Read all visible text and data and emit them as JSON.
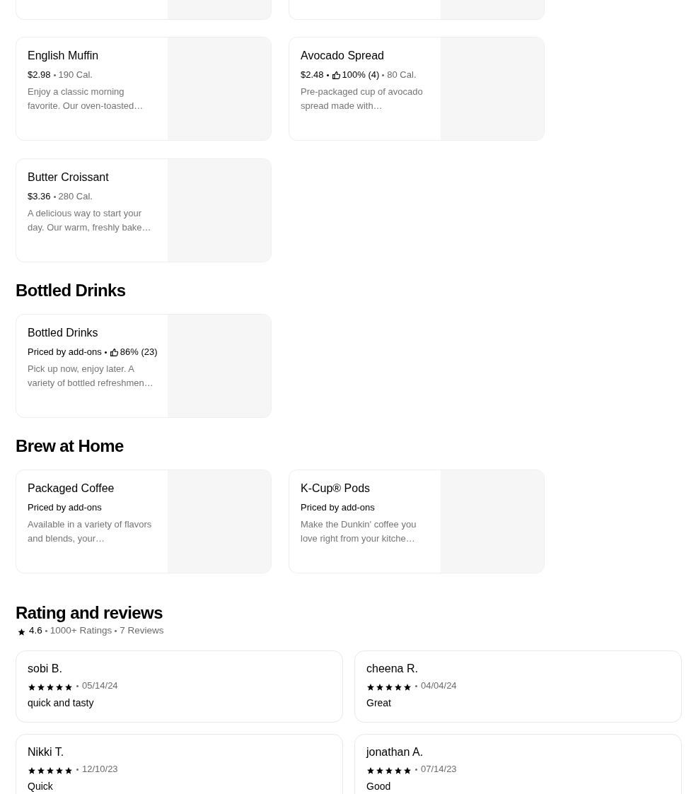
{
  "sections": [
    {
      "items": [
        {
          "cut_off": true
        },
        {
          "cut_off": true
        }
      ]
    },
    {
      "items": [
        {
          "cut_off": false,
          "name": "English Muffin",
          "meta": [
            {
              "kind": "price",
              "text": "$2.98"
            },
            {
              "kind": "calories",
              "text": "190 Cal."
            }
          ],
          "description": "Enjoy a classic morning favorite. Our oven-toasted…"
        },
        {
          "cut_off": false,
          "name": "Avocado Spread",
          "meta": [
            {
              "kind": "price",
              "text": "$2.48"
            },
            {
              "kind": "rating",
              "text": "100% (4)"
            },
            {
              "kind": "calories",
              "text": "80 Cal."
            }
          ],
          "description": "Pre-packaged cup of avocado spread made with…"
        },
        {
          "cut_off": false,
          "name": "Butter Croissant",
          "meta": [
            {
              "kind": "price",
              "text": "$3.36"
            },
            {
              "kind": "calories",
              "text": "280 Cal."
            }
          ],
          "description": "A delicious way to start your day. Our warm, freshly bake…"
        }
      ]
    },
    {
      "heading": "Bottled Drinks",
      "items": [
        {
          "cut_off": false,
          "name": "Bottled Drinks",
          "meta": [
            {
              "kind": "price",
              "text": "Priced by add-ons"
            },
            {
              "kind": "rating",
              "text": "86% (23)"
            }
          ],
          "description": "Pick up now, enjoy later. A variety of bottled refreshmen…"
        }
      ]
    },
    {
      "heading": "Brew at Home",
      "items": [
        {
          "cut_off": false,
          "name": "Packaged Coffee",
          "meta": [
            {
              "kind": "price",
              "text": "Priced by add-ons"
            }
          ],
          "description": "Available in a variety of flavors and blends, your…"
        },
        {
          "cut_off": false,
          "name": "K-Cup® Pods",
          "meta": [
            {
              "kind": "price",
              "text": "Priced by add-ons"
            }
          ],
          "description": "Make the Dunkin' coffee you love right from your kitche…"
        }
      ]
    }
  ],
  "reviews_section": {
    "heading": "Rating and reviews",
    "rating": "4.6",
    "ratings_count": "1000+ Ratings",
    "reviews_count": "7 Reviews",
    "reviews": [
      {
        "name": "sobi B.",
        "stars": 5,
        "date": "05/14/24",
        "text": "quick and tasty"
      },
      {
        "name": "cheena R.",
        "stars": 5,
        "date": "04/04/24",
        "text": "Great"
      },
      {
        "name": "Nikki T.",
        "stars": 5,
        "date": "12/10/23",
        "text": "Quick"
      },
      {
        "name": "jonathan A.",
        "stars": 5,
        "date": "07/14/23",
        "text": "Good"
      }
    ]
  }
}
